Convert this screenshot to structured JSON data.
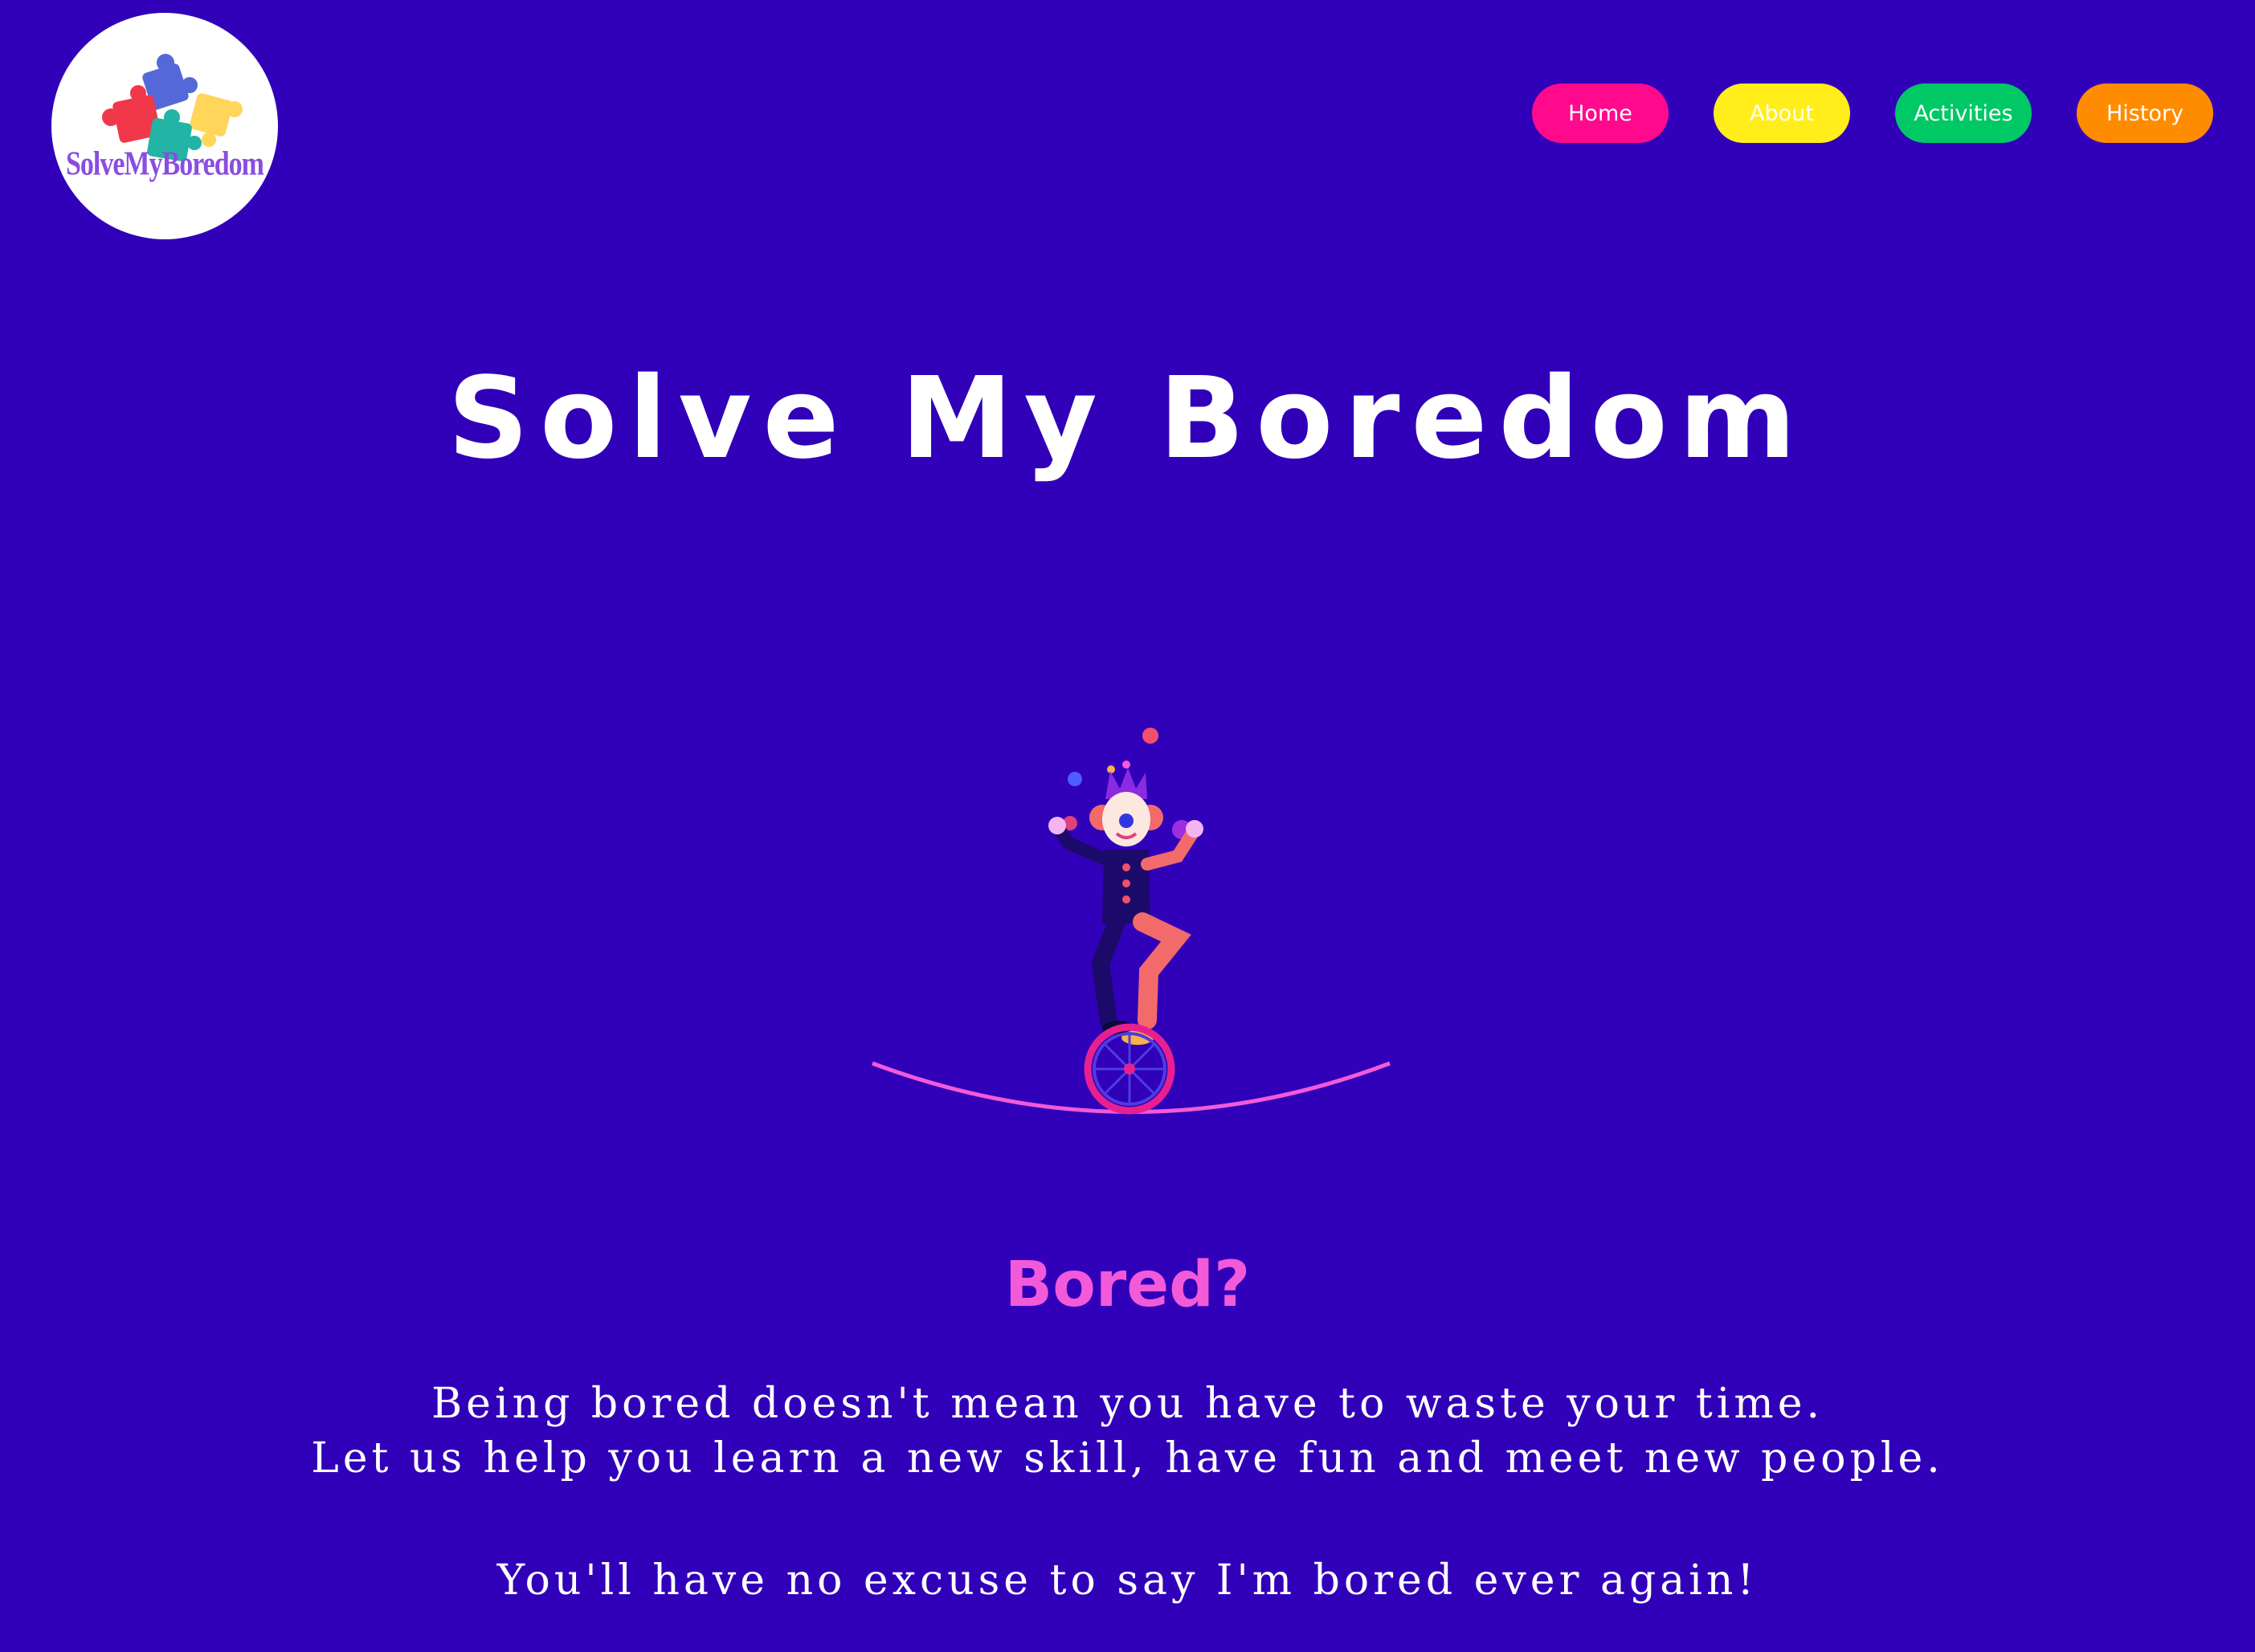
{
  "logo": {
    "text": "SolveMyBoredom"
  },
  "nav": {
    "items": [
      {
        "label": "Home",
        "color": "#ff0a8c"
      },
      {
        "label": "About",
        "color": "#ffee1a"
      },
      {
        "label": "Activities",
        "color": "#00c865"
      },
      {
        "label": "History",
        "color": "#ff8c00"
      }
    ]
  },
  "hero": {
    "title": "Solve My Boredom",
    "illustration": "clown-on-unicycle-tightrope"
  },
  "intro": {
    "heading": "Bored?",
    "line1": "Being bored doesn't mean you have to waste your time.",
    "line2": "Let us help you learn a new skill, have fun and meet new people.",
    "line3": "You'll have no excuse to say I'm bored ever again!"
  },
  "colors": {
    "background": "#3100b9",
    "heading_accent": "#f25ad9"
  }
}
